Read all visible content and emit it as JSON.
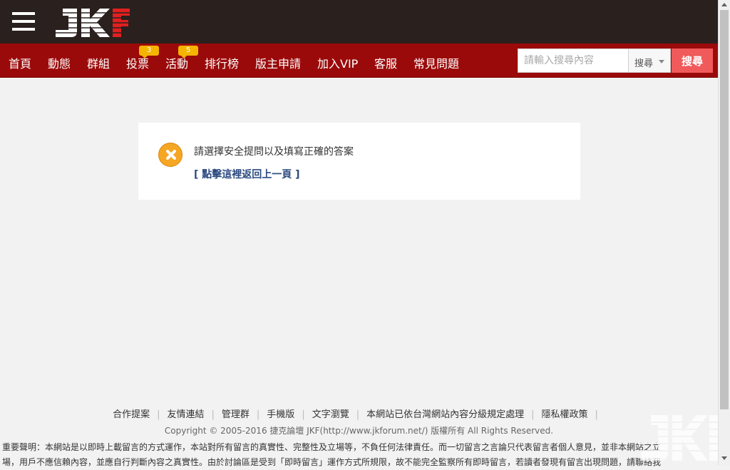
{
  "header": {
    "menu_icon": "hamburger-menu-icon",
    "logo_text": "JKF"
  },
  "nav": {
    "items": [
      {
        "label": "首頁"
      },
      {
        "label": "動態"
      },
      {
        "label": "群組"
      },
      {
        "label": "投票",
        "badge": "3"
      },
      {
        "label": "活動",
        "badge": "5"
      },
      {
        "label": "排行榜"
      },
      {
        "label": "版主申請"
      },
      {
        "label": "加入VIP"
      },
      {
        "label": "客服"
      },
      {
        "label": "常見問題"
      }
    ]
  },
  "search": {
    "placeholder": "請輸入搜尋內容",
    "type_label": "搜尋",
    "button_label": "搜尋"
  },
  "message": {
    "icon": "error-x-icon",
    "text": "請選擇安全提問以及填寫正確的答案",
    "link": "[ 點擊這裡返回上一頁 ]"
  },
  "footer": {
    "links": [
      "合作提案",
      "友情連結",
      "管理群",
      "手機版",
      "文字瀏覽",
      "本網站已依台灣網站內容分級規定處理",
      "隱私權政策"
    ],
    "copyright": "Copyright © 2005-2016 捷克論壇 JKF(http://www.jkforum.net/) 版權所有 All Rights Reserved.",
    "disclaimer_line1": "重要聲明：本網站是以即時上載留言的方式運作，本站對所有留言的真實性、完整性及立場等，不負任何法律責任。而一切留言之言論只代表留言者個人意見，並非本網站之立",
    "disclaimer_line2": "場，用戶不應信賴內容，並應自行判斷內容之真實性。由於討論區是受到「即時留言」運作方式所規限，故不能完全監察所有即時留言，若讀者發現有留言出現問題，請聯絡我"
  },
  "colors": {
    "topbar": "#2a201e",
    "navbar": "#9b0a0a",
    "search_button": "#f05a5a",
    "badge": "#f5b400",
    "error_icon": "#f5a623",
    "link": "#2b4a80"
  }
}
